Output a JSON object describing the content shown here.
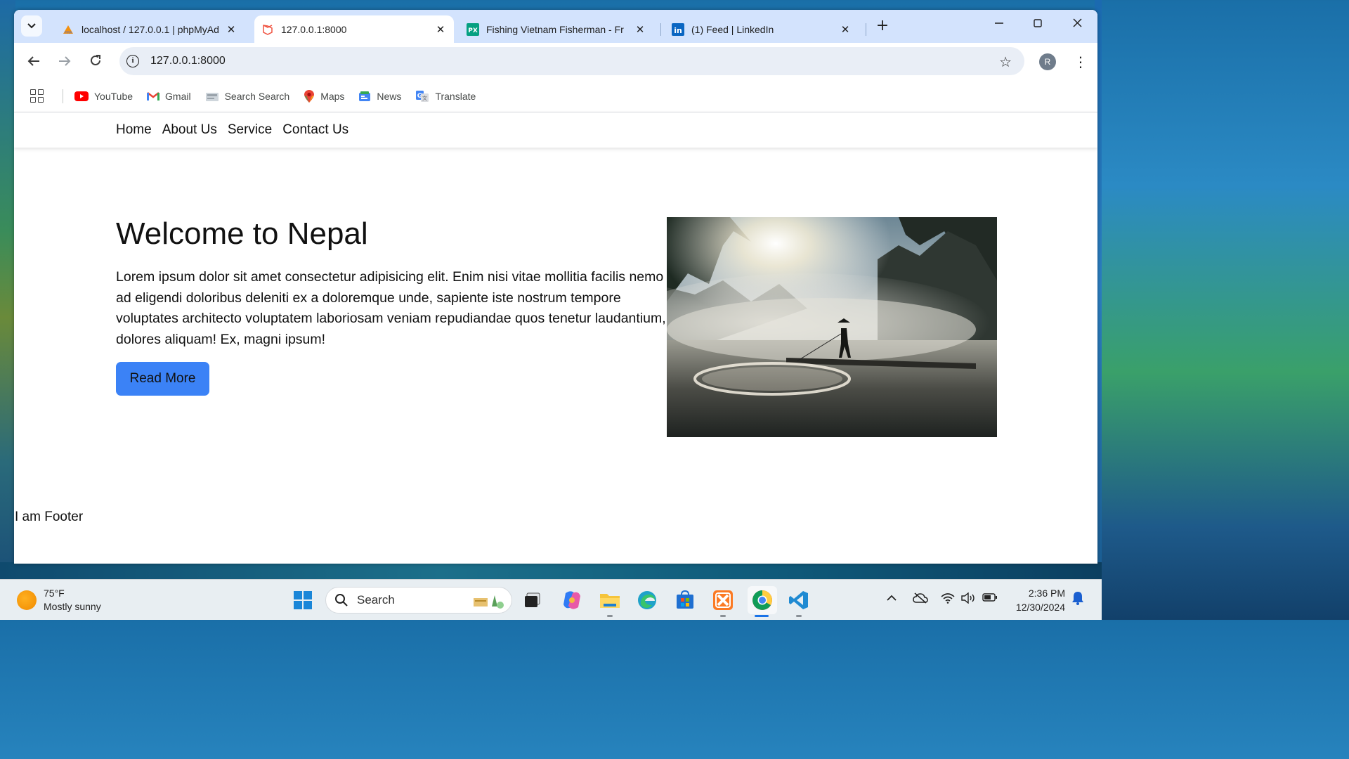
{
  "browser": {
    "tabs": [
      {
        "title": "localhost / 127.0.0.1 | phpMyAd",
        "active": false
      },
      {
        "title": "127.0.0.1:8000",
        "active": true
      },
      {
        "title": "Fishing Vietnam Fisherman - Fr",
        "active": false
      },
      {
        "title": "(1) Feed | LinkedIn",
        "active": false
      }
    ],
    "url": "127.0.0.1:8000",
    "profile_initial": "R",
    "bookmarks": [
      {
        "label": "YouTube",
        "icon": "youtube-icon"
      },
      {
        "label": "Gmail",
        "icon": "gmail-icon"
      },
      {
        "label": "Search Search",
        "icon": "search-search-icon"
      },
      {
        "label": "Maps",
        "icon": "maps-icon"
      },
      {
        "label": "News",
        "icon": "news-icon"
      },
      {
        "label": "Translate",
        "icon": "translate-icon"
      }
    ]
  },
  "page": {
    "nav": [
      "Home",
      "About Us",
      "Service",
      "Contact Us"
    ],
    "hero": {
      "title": "Welcome to Nepal",
      "body": "Lorem ipsum dolor sit amet consectetur adipisicing elit. Enim nisi vitae mollitia facilis nemo ad eligendi doloribus deleniti ex a doloremque unde, sapiente iste nostrum tempore voluptates architecto voluptatem laboriosam veniam repudiandae quos tenetur laudantium, dolores aliquam! Ex, magni ipsum!",
      "button": "Read More",
      "button_color": "#3b82f6"
    },
    "footer": "I am Footer"
  },
  "taskbar": {
    "weather_temp": "75°F",
    "weather_desc": "Mostly sunny",
    "search_placeholder": "Search",
    "time": "2:36 PM",
    "date": "12/30/2024"
  }
}
